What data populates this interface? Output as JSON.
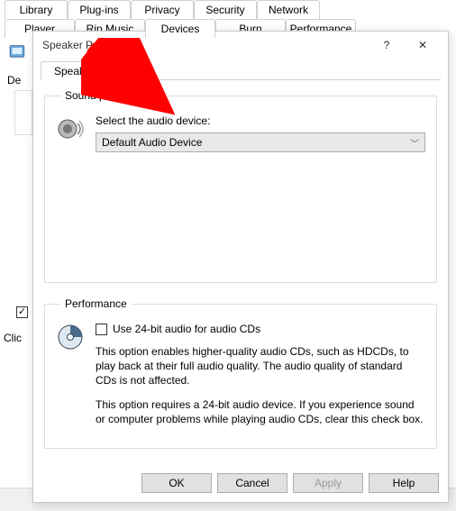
{
  "background": {
    "tabs_row1": [
      "Library",
      "Plug-ins",
      "Privacy",
      "Security",
      "Network"
    ],
    "tabs_row2": [
      "Player",
      "Rip Music",
      "Devices",
      "Burn",
      "Performance"
    ],
    "selected_tab": "Devices",
    "devices_label_fragment": "De",
    "click_label_fragment": "Clic"
  },
  "dialog": {
    "title": "Speaker Properties",
    "help_glyph": "?",
    "close_glyph": "✕",
    "tabs": [
      {
        "label": "Speakers"
      }
    ],
    "sound_group": {
      "legend": "Sound playback",
      "select_label": "Select the audio device:",
      "dropdown_value": "Default Audio Device"
    },
    "perf_group": {
      "legend": "Performance",
      "checkbox_label": "Use 24-bit audio for audio CDs",
      "checkbox_checked": false,
      "para1": "This option enables higher-quality audio CDs, such as HDCDs, to play back at their full audio quality. The audio quality of standard CDs is not affected.",
      "para2": "This option requires a 24-bit audio device. If you experience sound or computer problems while playing audio CDs, clear this check box."
    },
    "buttons": {
      "ok": "OK",
      "cancel": "Cancel",
      "apply": "Apply",
      "help": "Help"
    }
  },
  "annotation": {
    "arrow_color": "#ff0000"
  }
}
